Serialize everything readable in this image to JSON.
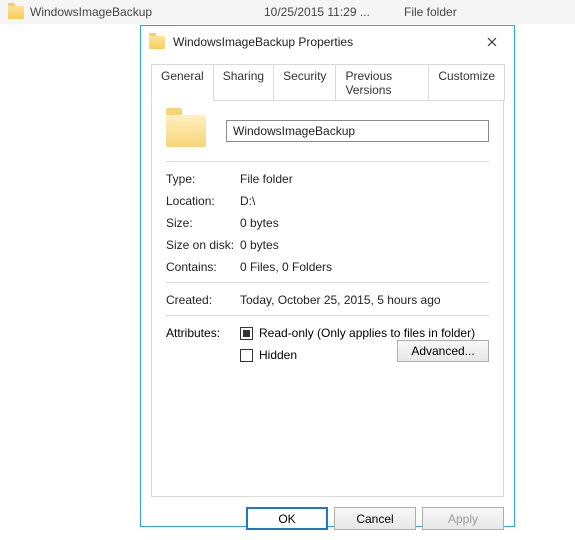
{
  "listing": {
    "name": "WindowsImageBackup",
    "date": "10/25/2015 11:29 ...",
    "type": "File folder"
  },
  "dialog": {
    "title": "WindowsImageBackup Properties",
    "tabs": [
      "General",
      "Sharing",
      "Security",
      "Previous Versions",
      "Customize"
    ],
    "name_value": "WindowsImageBackup",
    "labels": {
      "type": "Type:",
      "location": "Location:",
      "size": "Size:",
      "size_on_disk": "Size on disk:",
      "contains": "Contains:",
      "created": "Created:",
      "attributes": "Attributes:"
    },
    "values": {
      "type": "File folder",
      "location": "D:\\",
      "size": "0 bytes",
      "size_on_disk": "0 bytes",
      "contains": "0 Files, 0 Folders",
      "created": "Today, October 25, 2015, 5 hours ago"
    },
    "attributes": {
      "readonly_label": "Read-only (Only applies to files in folder)",
      "hidden_label": "Hidden",
      "advanced_label": "Advanced..."
    },
    "buttons": {
      "ok": "OK",
      "cancel": "Cancel",
      "apply": "Apply"
    }
  }
}
